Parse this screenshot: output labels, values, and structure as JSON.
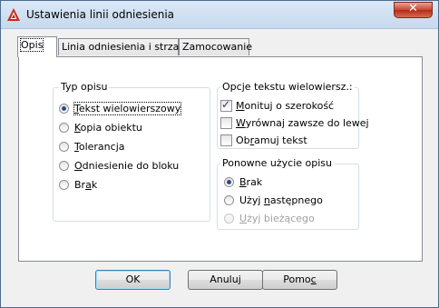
{
  "window": {
    "title": "Ustawienia linii odniesienia",
    "close_symbol": "✕"
  },
  "tabs": [
    {
      "label": "Opis",
      "active": true
    },
    {
      "label": "Linia odniesienia i strzałka",
      "active": false
    },
    {
      "label": "Zamocowanie",
      "active": false
    }
  ],
  "typ_opisu": {
    "legend": "Typ opisu",
    "options": [
      {
        "pre": "",
        "u": "T",
        "post": "ekst wielowierszowy",
        "checked": true
      },
      {
        "pre": "",
        "u": "K",
        "post": "opia obiektu",
        "checked": false
      },
      {
        "pre": "",
        "u": "T",
        "post": "olerancja",
        "checked": false
      },
      {
        "pre": "",
        "u": "O",
        "post": "dniesienie do bloku",
        "checked": false
      },
      {
        "pre": "Br",
        "u": "a",
        "post": "k",
        "checked": false
      }
    ]
  },
  "opcje_tekstu": {
    "legend": "Opcje tekstu wielowiersz.:",
    "options": [
      {
        "pre": "",
        "u": "M",
        "post": "onituj o szerokość",
        "checked": true
      },
      {
        "pre": "",
        "u": "W",
        "post": "yrównaj zawsze do lewej",
        "checked": false
      },
      {
        "pre": "Ob",
        "u": "r",
        "post": "amuj tekst",
        "checked": false
      }
    ]
  },
  "ponowne_uzycie": {
    "legend": "Ponowne użycie opisu",
    "options": [
      {
        "pre": "",
        "u": "B",
        "post": "rak",
        "checked": true,
        "disabled": false
      },
      {
        "pre": "Użyj ",
        "u": "n",
        "post": "astępnego",
        "checked": false,
        "disabled": false
      },
      {
        "pre": "",
        "u": "U",
        "post": "żyj bieżącego",
        "checked": false,
        "disabled": true
      }
    ]
  },
  "buttons": {
    "ok": "OK",
    "cancel": "Anuluj",
    "help_pre": "Pomo",
    "help_u": "c"
  }
}
